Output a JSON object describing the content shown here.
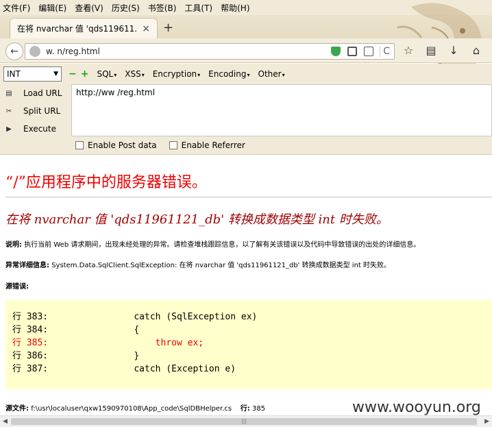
{
  "menu": [
    "文件(F)",
    "编辑(E)",
    "查看(V)",
    "历史(S)",
    "书签(B)",
    "工具(T)",
    "帮助(H)"
  ],
  "tab": {
    "title": "在将 nvarchar 值 'qds119611...",
    "close": "×",
    "new_tab": "+"
  },
  "navbar": {
    "url": "w.                    n/reg.html",
    "reload": "C"
  },
  "hackbar": {
    "select_value": "INT",
    "minus": "−",
    "plus": "+",
    "menus": [
      "SQL",
      "XSS",
      "Encryption",
      "Encoding",
      "Other"
    ],
    "side": [
      "Load URL",
      "Split URL",
      "Execute"
    ],
    "textarea_value": "http://ww                         /reg.html",
    "checkboxes": [
      "Enable Post data",
      "Enable Referrer"
    ]
  },
  "page": {
    "title": "“/”应用程序中的服务器错误。",
    "subtitle": "在将 nvarchar 值 'qds11961121_db' 转换成数据类型 int 时失败。",
    "description_label": "说明:",
    "description": "执行当前 Web 请求期间，出现未经处理的异常。请检查堆栈跟踪信息，以了解有关该错误以及代码中导致错误的出处的详细信息。",
    "exception_label": "异常详细信息:",
    "exception": "System.Data.SqlClient.SqlException: 在将 nvarchar 值 'qds11961121_db' 转换成数据类型 int 时失败。",
    "source_error_label": "源错误:",
    "code_lines": [
      "行 383:                catch (SqlException ex)",
      "行 384:                {",
      "行 385:                    throw ex;",
      "行 386:                }",
      "行 387:                catch (Exception e)"
    ],
    "source_file_label": "源文件:",
    "source_file": "f:\\usr\\localuser\\qxw1590970108\\App_code\\SqlDBHelper.cs",
    "line_label": "行:",
    "line": "385",
    "watermark": "www.wooyun.org"
  },
  "colors": {
    "error_red": "#e00000",
    "subtitle_red": "#a00000",
    "code_bg": "#ffffcc",
    "chrome_bg": "#f1ead8"
  }
}
